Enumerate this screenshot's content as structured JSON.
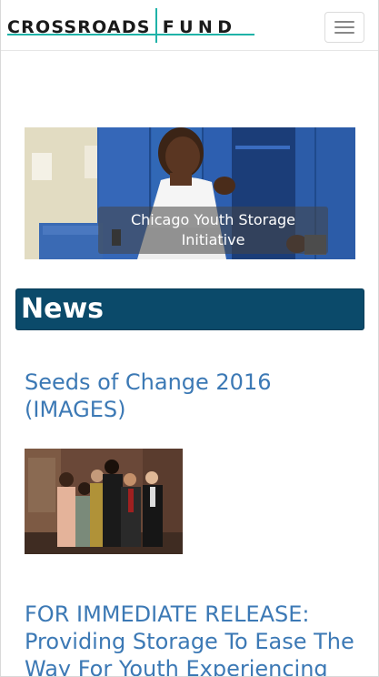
{
  "header": {
    "logo_left": "CROSSROADS",
    "logo_right": "FUND",
    "menu_icon": "hamburger-menu-icon",
    "brand_accent": "#1fb2a8"
  },
  "hero": {
    "caption": "Chicago Youth Storage Initiative"
  },
  "news": {
    "heading": "News",
    "banner_color": "#0b4a6a"
  },
  "articles": [
    {
      "title": "Seeds of Change 2016 (IMAGES)"
    },
    {
      "title": "FOR IMMEDIATE RELEASE: Providing Storage To Ease The Way For Youth Experiencing"
    }
  ],
  "colors": {
    "link": "#3c79b5"
  }
}
